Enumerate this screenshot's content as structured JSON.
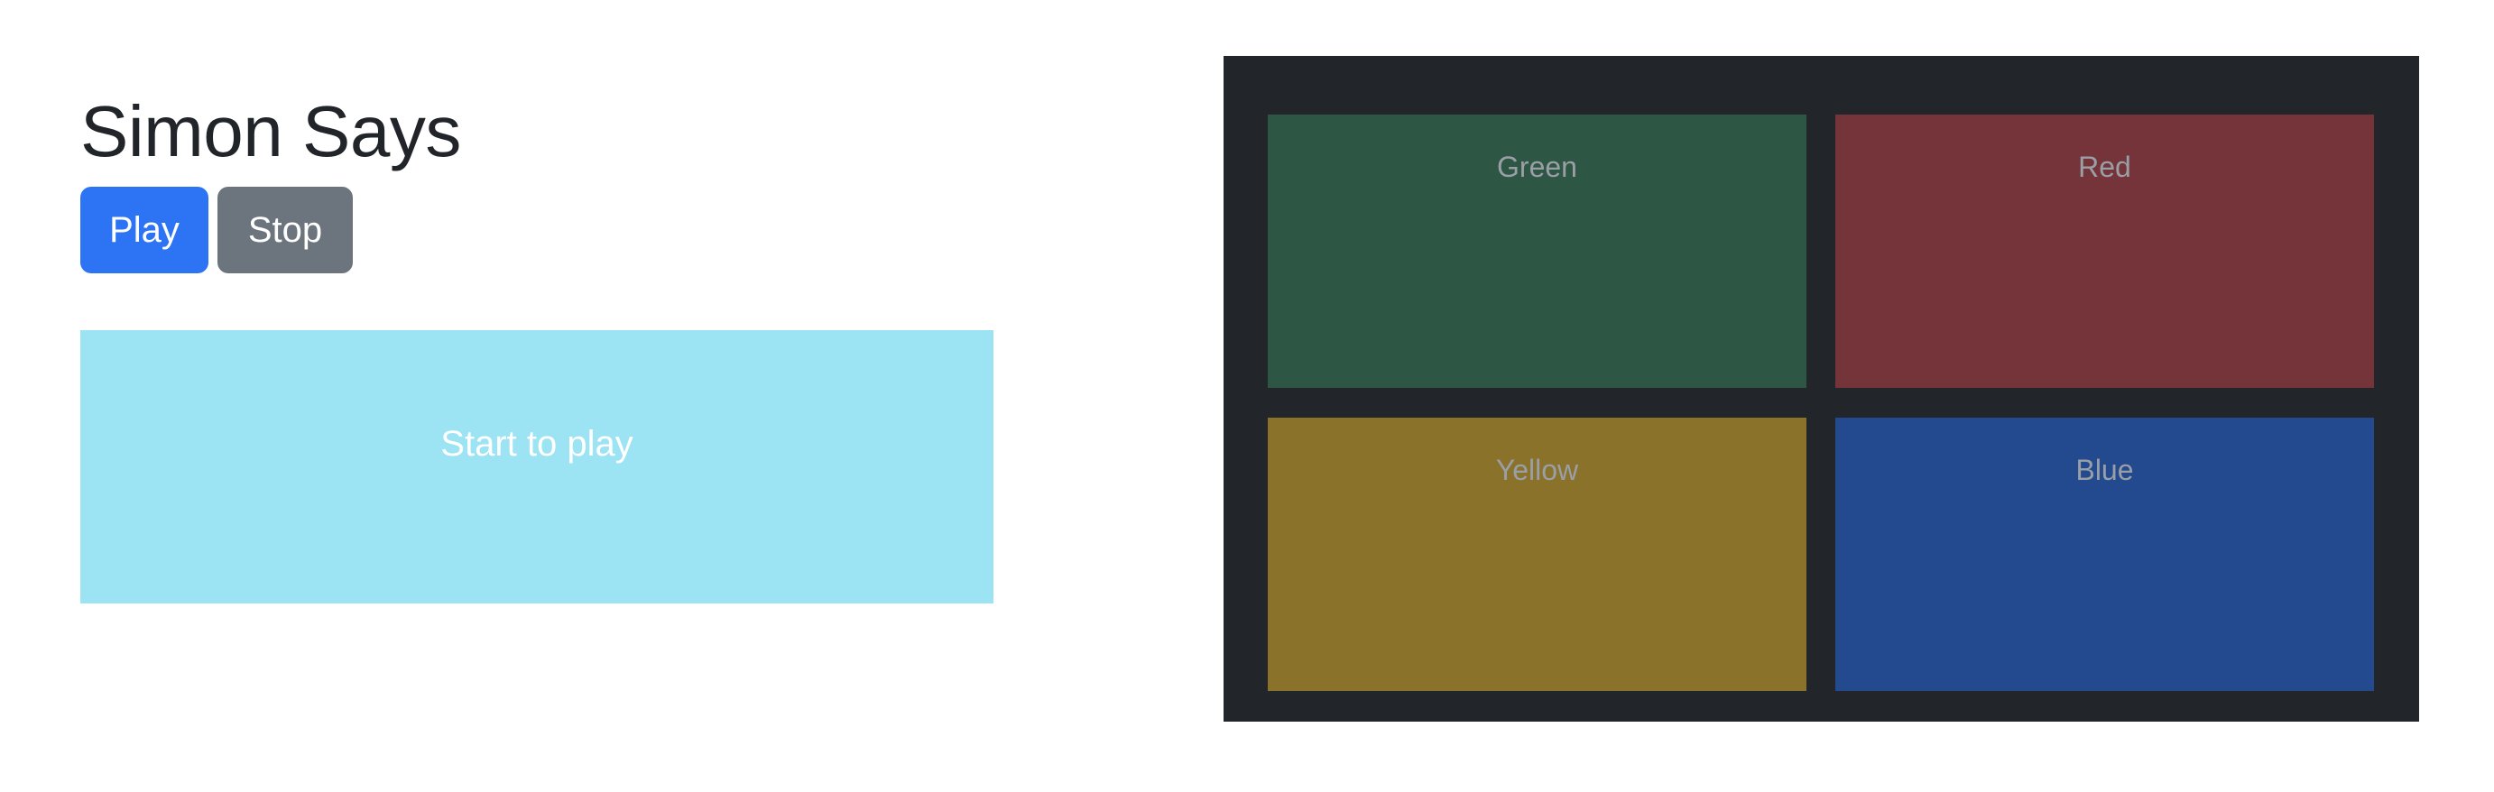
{
  "title": "Simon Says",
  "controls": {
    "play_label": "Play",
    "stop_label": "Stop"
  },
  "status": {
    "message": "Start to play"
  },
  "board": {
    "pads": [
      {
        "label": "Green",
        "color": "#2d5744"
      },
      {
        "label": "Red",
        "color": "#75333a"
      },
      {
        "label": "Yellow",
        "color": "#8a722b"
      },
      {
        "label": "Blue",
        "color": "#234a8e"
      }
    ]
  },
  "colors": {
    "play_button": "#2c74f4",
    "stop_button": "#6c757d",
    "status_background": "#9ce3f3",
    "board_background": "#222529"
  }
}
